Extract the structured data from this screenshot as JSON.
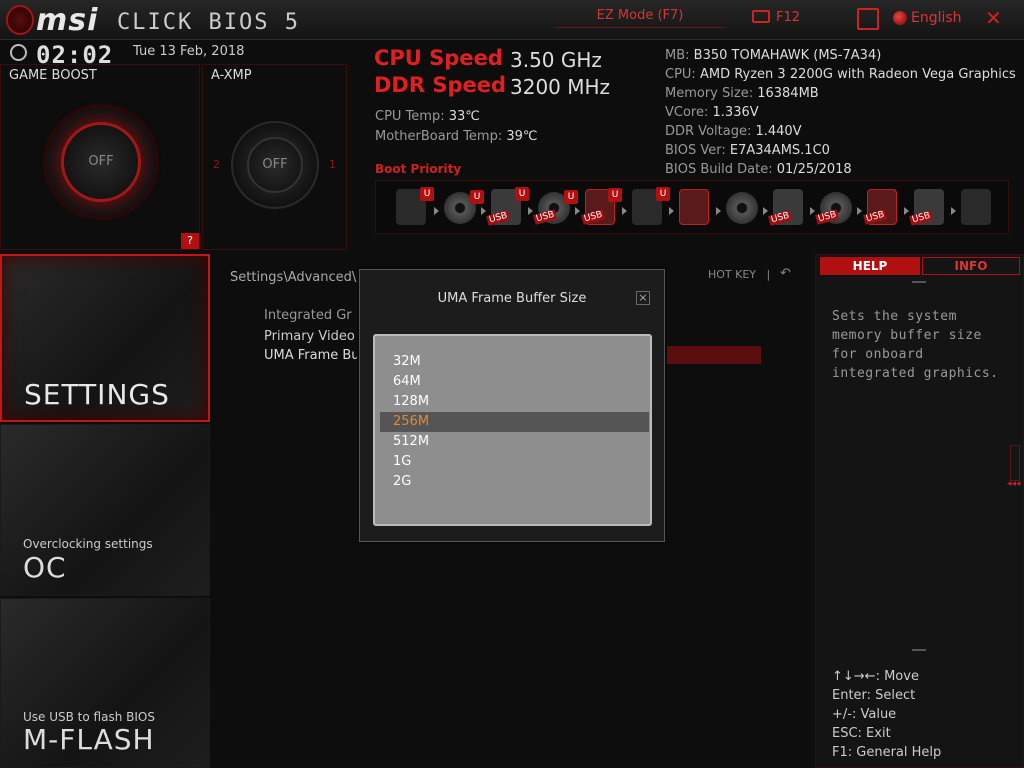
{
  "header": {
    "logo_msi": "msi",
    "logo_click_bios": "CLICK BIOS 5",
    "ez_mode": "EZ Mode (F7)",
    "f12": "F12",
    "language": "English",
    "close": "✕"
  },
  "status": {
    "time": "02:02",
    "date": "Tue  13 Feb, 2018"
  },
  "game_boost": {
    "title": "GAME BOOST",
    "state": "OFF"
  },
  "axmp": {
    "title": "A-XMP",
    "state": "OFF",
    "left_num": "2",
    "right_num": "1"
  },
  "help_q": "?",
  "speeds": {
    "cpu_label": "CPU Speed",
    "cpu_value": "3.50 GHz",
    "ddr_label": "DDR Speed",
    "ddr_value": "3200 MHz",
    "cpu_temp_label": "CPU Temp:",
    "cpu_temp_value": "33℃",
    "mb_temp_label": "MotherBoard Temp:",
    "mb_temp_value": "39℃"
  },
  "sysinfo": [
    {
      "label": "MB:",
      "value": "B350 TOMAHAWK (MS-7A34)"
    },
    {
      "label": "CPU:",
      "value": "AMD Ryzen 3 2200G with Radeon Vega Graphics"
    },
    {
      "label": "Memory Size:",
      "value": "16384MB"
    },
    {
      "label": "VCore:",
      "value": "1.336V"
    },
    {
      "label": "DDR Voltage:",
      "value": "1.440V"
    },
    {
      "label": "BIOS Ver:",
      "value": "E7A34AMS.1C0"
    },
    {
      "label": "BIOS Build Date:",
      "value": "01/25/2018"
    }
  ],
  "boot": {
    "label": "Boot Priority",
    "badge_u": "U",
    "usb_tag": "USB"
  },
  "sidebar": {
    "settings_label": "SETTINGS",
    "oc_sub": "Overclocking settings",
    "oc_label": "OC",
    "mflash_sub": "Use USB to flash BIOS",
    "mflash_label": "M-FLASH"
  },
  "main": {
    "breadcrumb": "Settings\\Advanced\\",
    "hotkey": "HOT KEY",
    "hotkey_sep": "|",
    "back": "↶",
    "rows": [
      "Integrated Gr",
      "Primary Video A",
      "UMA Frame Bu"
    ]
  },
  "dialog": {
    "title": "UMA Frame Buffer Size",
    "close": "×",
    "options": [
      "32M",
      "64M",
      "128M",
      "256M",
      "512M",
      "1G",
      "2G"
    ],
    "selected": "256M"
  },
  "help_panel": {
    "help_tab": "HELP",
    "info_tab": "INFO",
    "text": "Sets the system memory buffer size for onboard integrated graphics.",
    "keys": [
      "↑↓→←:  Move",
      "Enter:  Select",
      "+/-:  Value",
      "ESC:  Exit",
      "F1:  General Help"
    ],
    "side_arrows": "◂◂◂"
  }
}
